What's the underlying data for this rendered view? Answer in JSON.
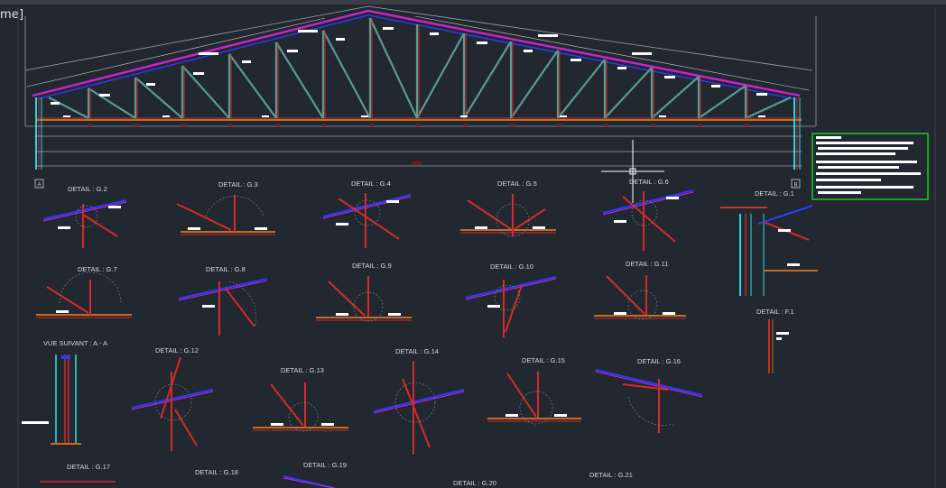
{
  "viewport": {
    "label": "me]"
  },
  "grid_tags": {
    "left": "A",
    "right": "B"
  },
  "details": [
    "DETAIL : G.2",
    "DETAIL : G.3",
    "DETAIL : G.4",
    "DETAIL : G.5",
    "DETAIL : G.6",
    "DETAIL : G.1",
    "DETAIL : G.7",
    "DETAIL : G.8",
    "DETAIL : G.9",
    "DETAIL : G.10",
    "DETAIL : G.11",
    "DETAIL : F.1",
    "VUE SUIVANT : A - A",
    "DETAIL : G.12",
    "DETAIL : G.13",
    "DETAIL : G.14",
    "DETAIL : G.15",
    "DETAIL : G.16",
    "DETAIL : G.17",
    "DETAIL : G.18",
    "DETAIL : G.19",
    "DETAIL : G.20",
    "DETAIL : G.21"
  ],
  "colors": {
    "background": "#212830",
    "top_chord": "#d020d0",
    "blue_chord": "#2a3cff",
    "web_members": "#5a9a90",
    "red_members": "#d42a2a",
    "bottom_chord": "#c86a20",
    "cyan_column": "#2ad6e0",
    "green_box": "#1ec81e"
  }
}
